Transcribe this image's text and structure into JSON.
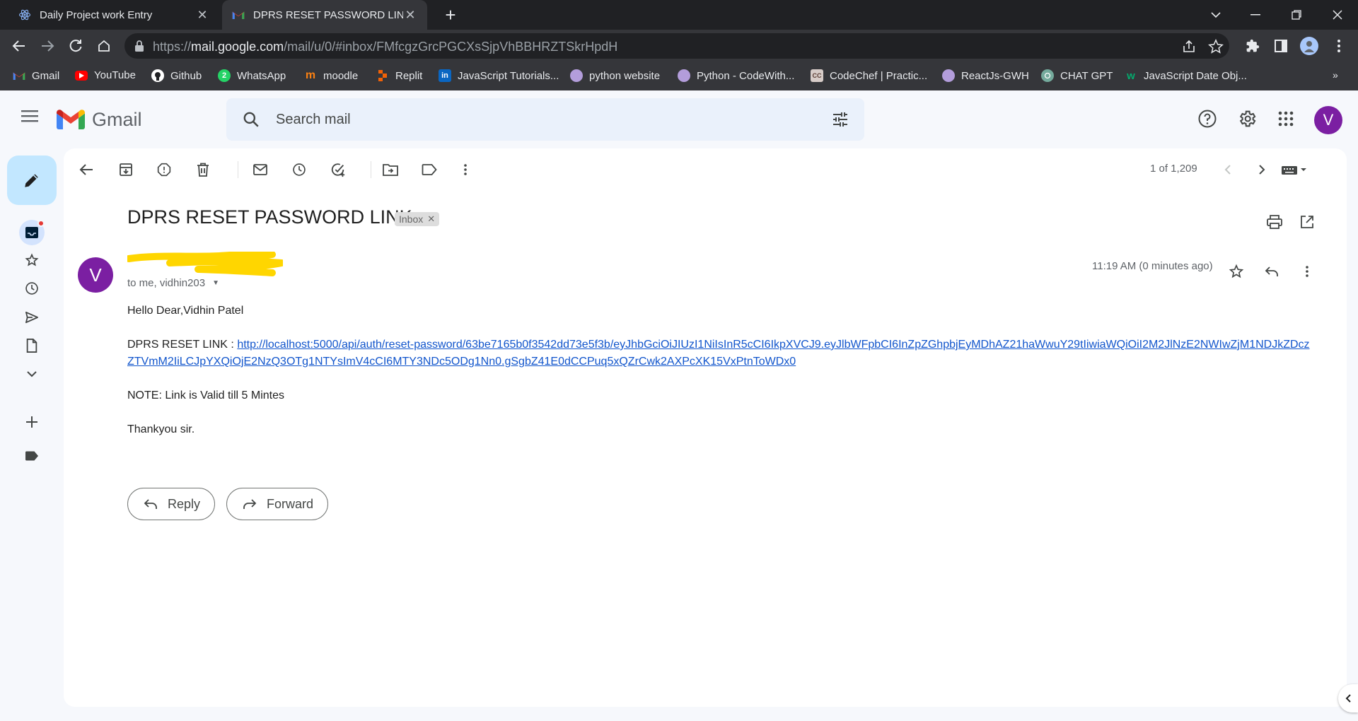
{
  "browser": {
    "tabs": [
      {
        "title": "Daily Project work Entry",
        "active": false
      },
      {
        "title": "DPRS RESET PASSWORD LINK - v",
        "active": true
      }
    ],
    "url_host": "mail.google.com",
    "url_prefix": "https://",
    "url_path": "/mail/u/0/#inbox/FMfcgzGrcPGCXsSjpVhBBHRZTSkrHpdH",
    "bookmarks": [
      {
        "label": "Gmail",
        "icon": "gmail-icon",
        "color": "#ea4335"
      },
      {
        "label": "YouTube",
        "icon": "youtube-icon",
        "color": "#ff0000"
      },
      {
        "label": "Github",
        "icon": "github-icon",
        "color": "#ffffff"
      },
      {
        "label": "WhatsApp",
        "icon": "whatsapp-icon",
        "color": "#25d366"
      },
      {
        "label": "moodle",
        "icon": "moodle-icon",
        "color": "#f98012"
      },
      {
        "label": "Replit",
        "icon": "replit-icon",
        "color": "#f26207"
      },
      {
        "label": "JavaScript Tutorials...",
        "icon": "linkedin-icon",
        "color": "#0a66c2"
      },
      {
        "label": "python website",
        "icon": "avatar-icon",
        "color": "#b39ddb"
      },
      {
        "label": "Python - CodeWith...",
        "icon": "avatar-icon",
        "color": "#b39ddb"
      },
      {
        "label": "CodeChef | Practic...",
        "icon": "codechef-icon",
        "color": "#d7ccc8"
      },
      {
        "label": "ReactJs-GWH",
        "icon": "avatar-icon",
        "color": "#b39ddb"
      },
      {
        "label": "CHAT GPT",
        "icon": "chatgpt-icon",
        "color": "#74aa9c"
      },
      {
        "label": "JavaScript Date Obj...",
        "icon": "w3schools-icon",
        "color": "#04aa6d"
      }
    ]
  },
  "gmail": {
    "brand": "Gmail",
    "search_placeholder": "Search mail",
    "user_initial": "V",
    "pager": "1 of 1,209",
    "subject": "DPRS RESET PASSWORD LINK",
    "label_badge": "Inbox",
    "sender_initial": "V",
    "recipients": "to me, vidhin203",
    "time": "11:19 AM (0 minutes ago)",
    "body": {
      "greeting": "Hello Dear,Vidhin Patel",
      "link_prefix": "DPRS RESET LINK : ",
      "link": "http://localhost:5000/api/auth/reset-password/63be7165b0f3542dd73e5f3b/eyJhbGciOiJIUzI1NiIsInR5cCI6IkpXVCJ9.eyJlbWFpbCI6InZpZGhpbjEyMDhAZ21haWwuY29tIiwiaWQiOiI2M2JlNzE2NWIwZjM1NDJkZDczZTVmM2IiLCJpYXQiOjE2NzQ3OTg1NTYsImV4cCI6MTY3NDc5ODg1Nn0.gSgbZ41E0dCCPuq5xQZrCwk2AXPcXK15VxPtnToWDx0",
      "note": "NOTE: Link is Valid till 5 Mintes",
      "closing": "Thankyou sir."
    },
    "reply_label": "Reply",
    "forward_label": "Forward"
  }
}
